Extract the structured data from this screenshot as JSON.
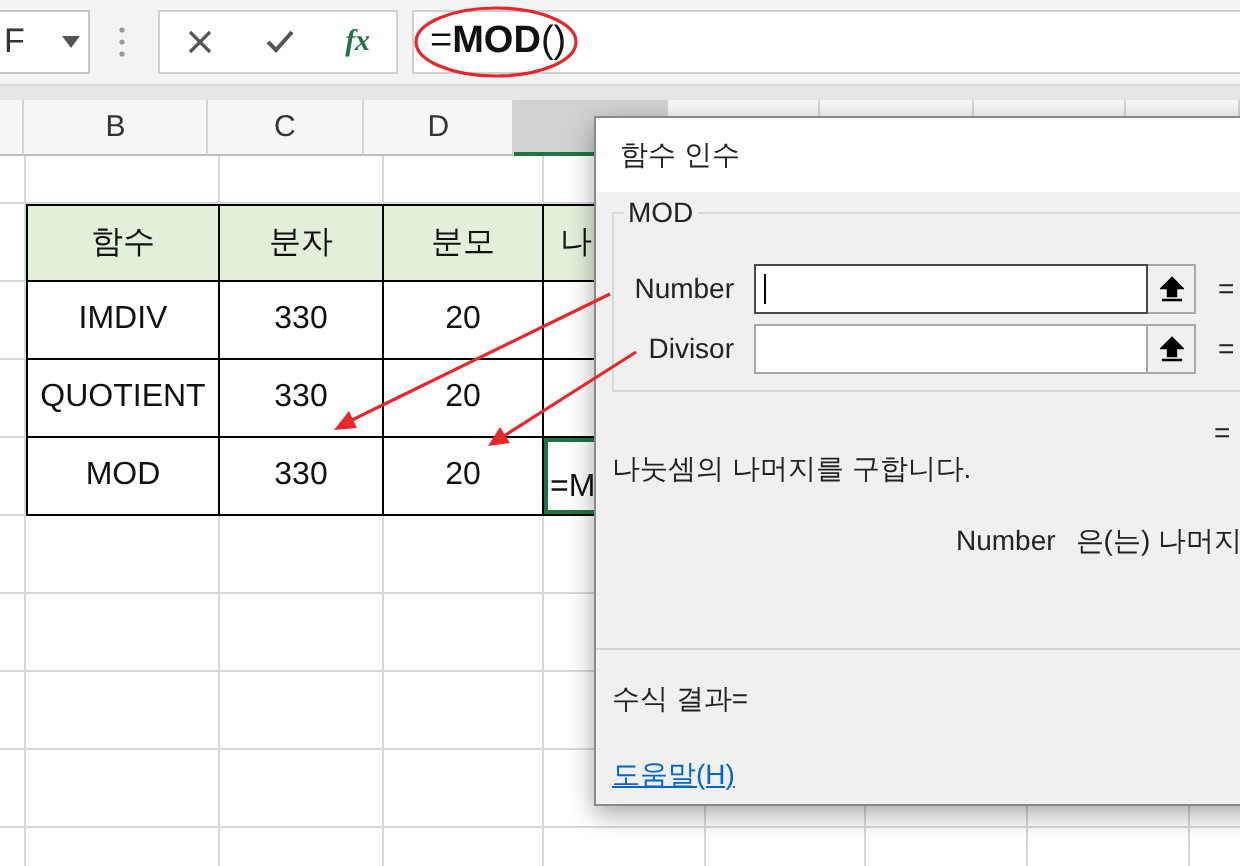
{
  "formula_bar": {
    "name_box": "F",
    "function_label": "fx",
    "formula": "=**MOD**()"
  },
  "column_headers": [
    {
      "selected": false
    },
    {
      "label": "B",
      "selected": false
    },
    {
      "label": "C",
      "selected": false
    },
    {
      "label": "D",
      "selected": false
    },
    {
      "selected": true
    },
    {
      "selected": false
    },
    {
      "selected": false
    },
    {
      "selected": false
    },
    {
      "selected": false
    }
  ],
  "table": {
    "rows": [
      {
        "kind": "header",
        "cells": [
          {
            "text": "함수",
            "selected": false
          },
          {
            "text": "분자",
            "selected": false
          },
          {
            "text": "분모",
            "selected": false
          },
          {
            "text": "나",
            "selected": false
          }
        ]
      },
      {
        "kind": "data",
        "cells": [
          {
            "text": "IMDIV",
            "selected": false
          },
          {
            "text": "330",
            "selected": false
          },
          {
            "text": "20",
            "selected": false
          },
          {
            "selected": false
          }
        ]
      },
      {
        "kind": "data",
        "cells": [
          {
            "text": "QUOTIENT",
            "selected": false
          },
          {
            "text": "330",
            "selected": false
          },
          {
            "text": "20",
            "selected": false
          },
          {
            "selected": false
          }
        ]
      },
      {
        "kind": "data",
        "cells": [
          {
            "text": "MOD",
            "selected": false
          },
          {
            "text": "330",
            "selected": false
          },
          {
            "text": "20",
            "selected": false
          },
          {
            "text": "=M",
            "selected": true
          }
        ]
      }
    ]
  },
  "dialog": {
    "title": "함수 인수",
    "group": "MOD",
    "arguments": [
      {
        "label": "Number",
        "focused": true,
        "result": "="
      },
      {
        "label": "Divisor",
        "focused": false,
        "result": "="
      }
    ],
    "result": "=",
    "description": "나눗셈의 나머지를 구합니다.",
    "argument_help": {
      "name": "Number",
      "text": "은(는) 나머지"
    },
    "formula_result": "수식 결과=",
    "help_link": "도움말(H)"
  }
}
